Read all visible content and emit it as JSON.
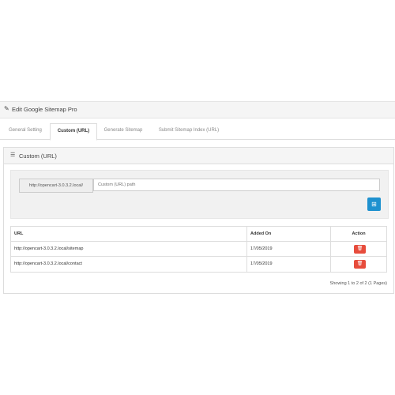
{
  "header": {
    "title": "Edit Google Sitemap Pro",
    "icon": "pencil-icon"
  },
  "tabs": [
    {
      "label": "General Setting",
      "active": false
    },
    {
      "label": "Custom (URL)",
      "active": true
    },
    {
      "label": "Generate Sitemap",
      "active": false
    },
    {
      "label": "Submit Sitemap Index (URL)",
      "active": false
    }
  ],
  "section": {
    "title": "Custom (URL)",
    "icon": "list-icon"
  },
  "form": {
    "prefix": "http://opencart-3.0.3.2.local/",
    "placeholder": "Custom (URL) path",
    "add_icon": "plus-icon",
    "add_color": "#1e91cf"
  },
  "table": {
    "headers": {
      "url": "URL",
      "added_on": "Added On",
      "action": "Action"
    },
    "rows": [
      {
        "url": "http://opencart-3.0.3.2.local/sitemap",
        "added_on": "17/05/2019"
      },
      {
        "url": "http://opencart-3.0.3.2.local/contact",
        "added_on": "17/05/2019"
      }
    ],
    "delete_color": "#e74c3c"
  },
  "pagination": {
    "text": "Showing 1 to 2 of 2 (1 Pages)"
  }
}
